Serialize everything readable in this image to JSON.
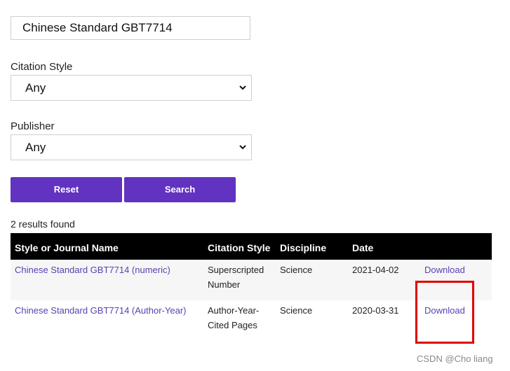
{
  "search": {
    "value": "Chinese Standard GBT7714"
  },
  "citation_style": {
    "label": "Citation Style",
    "selected": "Any"
  },
  "publisher": {
    "label": "Publisher",
    "selected": "Any"
  },
  "buttons": {
    "reset": "Reset",
    "search": "Search"
  },
  "results": {
    "count_text": "2 results found",
    "headers": [
      "Style or Journal Name",
      "Citation Style",
      "Discipline",
      "Date",
      ""
    ],
    "rows": [
      {
        "name": "Chinese Standard GBT7714 (numeric)",
        "style": "Superscripted Number",
        "discipline": "Science",
        "date": "2021-04-02",
        "action": "Download"
      },
      {
        "name": "Chinese Standard GBT7714 (Author-Year)",
        "style": "Author-Year-Cited Pages",
        "discipline": "Science",
        "date": "2020-03-31",
        "action": "Download"
      }
    ]
  },
  "colors": {
    "accent": "#6133c0",
    "link": "#5a3fb0",
    "highlight": "#e00000"
  },
  "watermark": "CSDN @Cho liang"
}
